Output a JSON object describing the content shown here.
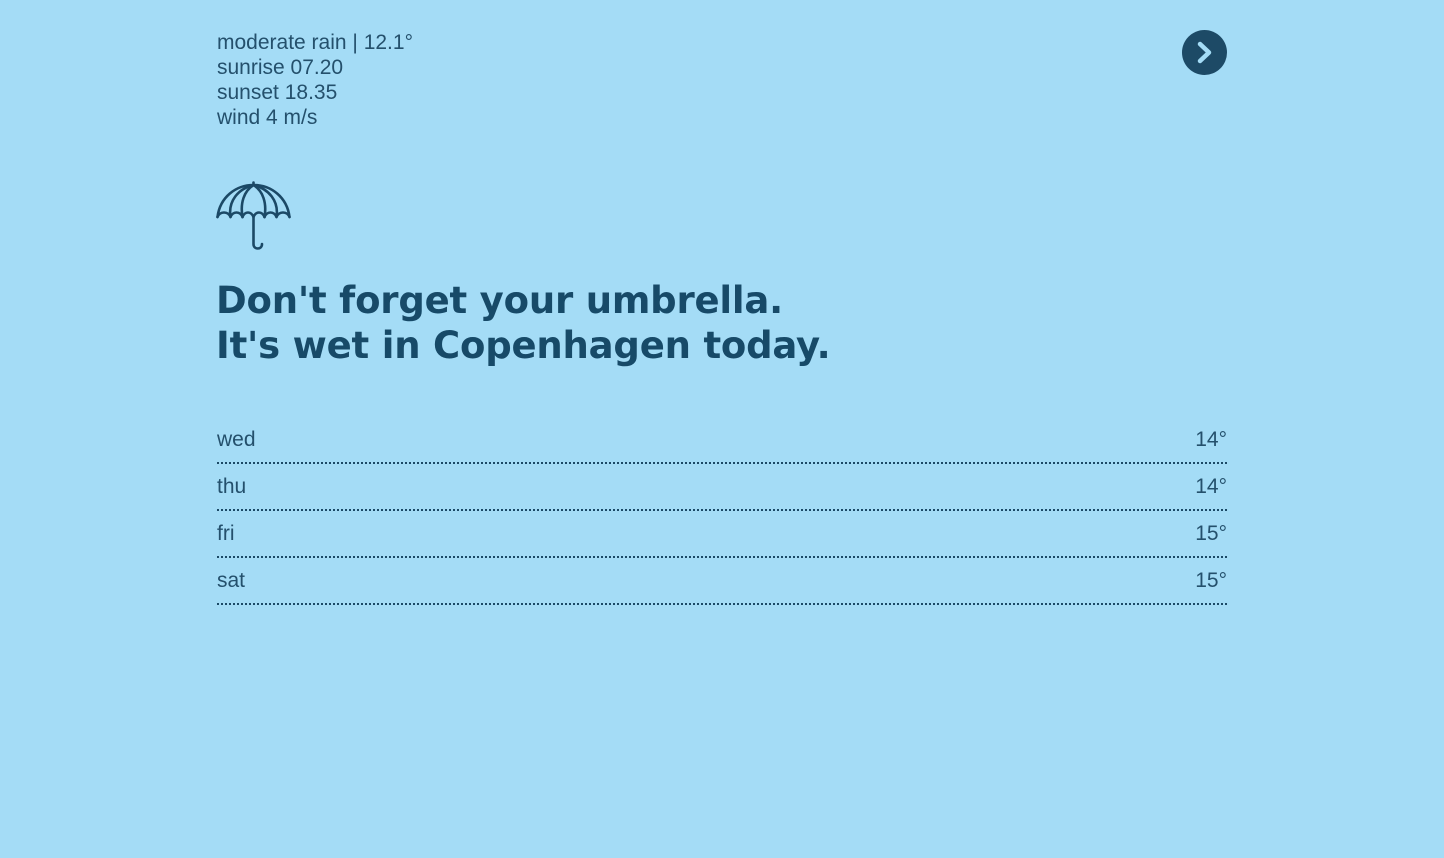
{
  "stats": {
    "condition": "moderate rain | 12.1°",
    "sunrise": "sunrise 07.20",
    "sunset": "sunset 18.35",
    "wind": "wind 4 m/s"
  },
  "nav": {
    "next_icon": "chevron-right-icon"
  },
  "weather_icon": "umbrella-icon",
  "headline": {
    "line1": "Don't forget your umbrella.",
    "line2": "It's wet in Copenhagen today."
  },
  "forecast": [
    {
      "day": "wed",
      "temp": "14°"
    },
    {
      "day": "thu",
      "temp": "14°"
    },
    {
      "day": "fri",
      "temp": "15°"
    },
    {
      "day": "sat",
      "temp": "15°"
    }
  ],
  "colors": {
    "background": "#a4dcf6",
    "accent": "#1d4a66"
  }
}
